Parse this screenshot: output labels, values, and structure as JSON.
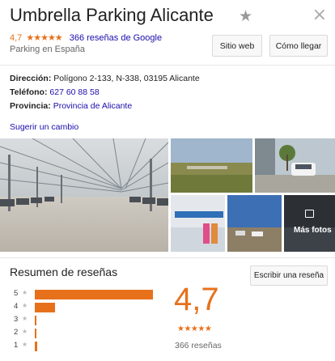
{
  "place": {
    "name": "Umbrella Parking Alicante",
    "rating": "4,7",
    "rating_stars": "★★★★★",
    "reviews_link": "366 reseñas de Google",
    "category": "Parking en España"
  },
  "actions": {
    "website_label": "Sitio web",
    "directions_label": "Cómo llegar",
    "save_icon": "★",
    "close_icon": "×"
  },
  "info": {
    "address_label": "Dirección:",
    "address_value": "Polígono 2-133, N-338, 03195 Alicante",
    "phone_label": "Teléfono:",
    "phone_value": "627 60 88 58",
    "province_label": "Provincia:",
    "province_value": "Provincia de Alicante",
    "suggest_edit": "Sugerir un cambio"
  },
  "photos": {
    "more_label": "Más fotos"
  },
  "reviews": {
    "title": "Resumen de reseñas",
    "write_label": "Escribir una reseña",
    "score": "4,7",
    "score_stars": "★★★★★",
    "total": "366 reseñas",
    "star_glyph": "★",
    "distribution": [
      {
        "stars": "5",
        "fraction": 0.88
      },
      {
        "stars": "4",
        "fraction": 0.15
      },
      {
        "stars": "3",
        "fraction": 0.01
      },
      {
        "stars": "2",
        "fraction": 0.01
      },
      {
        "stars": "1",
        "fraction": 0.02
      }
    ]
  },
  "colors": {
    "accent": "#e7711b",
    "link": "#1a0dab"
  }
}
